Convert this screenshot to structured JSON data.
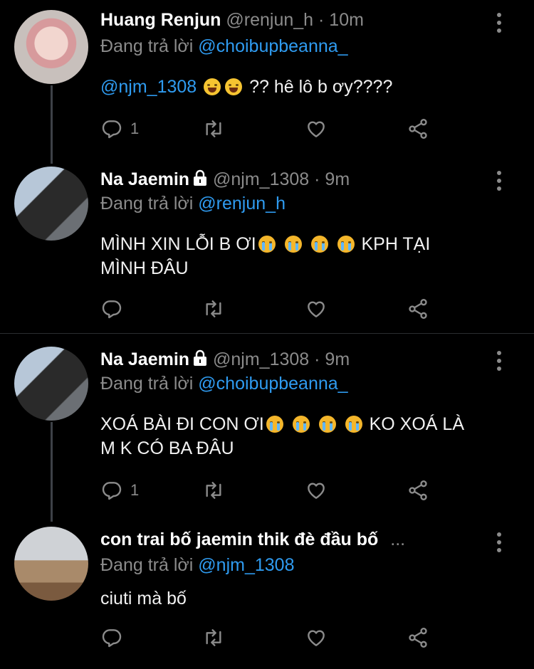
{
  "tweets": [
    {
      "name": "Huang Renjun",
      "handle": "@renjun_h",
      "time": "· 10m",
      "reply_prefix": "Đang trả lời",
      "reply_to": "@choibupbeanna_",
      "mention": "@njm_1308",
      "text_after": " ?? hê lô b ơy????",
      "reply_count": "1",
      "avatar_color": "#d8b7b5"
    },
    {
      "name": "Na Jaemin",
      "handle": "@njm_1308",
      "time": "· 9m",
      "reply_prefix": "Đang trả lời",
      "reply_to": "@renjun_h",
      "text_line1": "MÌNH XIN LỖI B ƠI",
      "text_line1_after": " KPH TẠI",
      "text_line2": "MÌNH ĐÂU",
      "reply_count": "",
      "avatar_color": "#5a6c84"
    },
    {
      "name": "Na Jaemin",
      "handle": "@njm_1308",
      "time": "· 9m",
      "reply_prefix": "Đang trả lời",
      "reply_to": "@choibupbeanna_",
      "text_line1": "XOÁ BÀI ĐI CON ƠI",
      "text_line1_after": " KO XOÁ LÀ",
      "text_line2": "M K CÓ BA ĐÂU",
      "reply_count": "1",
      "avatar_color": "#5a6c84"
    },
    {
      "name": "con trai bố jaemin thik đè đầu bố",
      "handle": "...",
      "reply_prefix": "Đang trả lời",
      "reply_to": "@njm_1308",
      "text": "ciuti mà bố",
      "reply_count": "",
      "avatar_color": "#9b7f63"
    }
  ],
  "icons": [
    "reply-icon",
    "retweet-icon",
    "like-icon",
    "share-icon",
    "more-icon",
    "lock-icon"
  ],
  "colors": {
    "background": "#000000",
    "link": "#2f9bf0",
    "muted": "#8b8b8b",
    "text": "#f1f1f1"
  }
}
